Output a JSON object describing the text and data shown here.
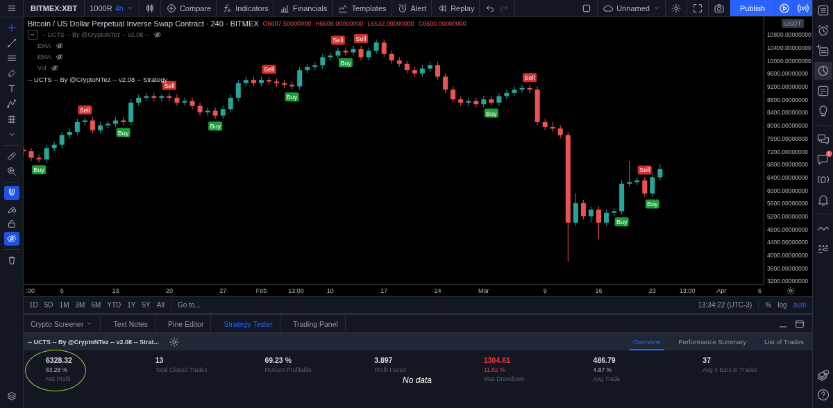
{
  "topbar": {
    "symbol": "BITMEX:XBT",
    "chart_style": "1000R",
    "interval": "4h",
    "buttons": [
      {
        "label": "Compare"
      },
      {
        "label": "Indicators"
      },
      {
        "label": "Financials"
      },
      {
        "label": "Templates"
      },
      {
        "label": "Alert"
      },
      {
        "label": "Replay"
      }
    ],
    "layout_name": "Unnamed",
    "publish": "Publish"
  },
  "left_toolbar": [
    {
      "selected": true,
      "on": false
    },
    {
      "selected": false,
      "on": false
    },
    {
      "selected": false,
      "on": false
    },
    {
      "selected": false,
      "on": false
    },
    {
      "selected": false,
      "on": false
    },
    {
      "selected": false,
      "on": false
    },
    {
      "selected": false,
      "on": false
    },
    {
      "selected": false,
      "on": false
    },
    {
      "selected": false,
      "on": false
    },
    {
      "selected": false,
      "on": false
    },
    {
      "selected": false,
      "on": true
    },
    {
      "selected": false,
      "on": false
    },
    {
      "selected": false,
      "on": false
    },
    {
      "selected": false,
      "on": true
    },
    {
      "selected": false,
      "on": false
    }
  ],
  "right_sidebar": [
    {
      "selected": false
    },
    {
      "selected": false
    },
    {
      "selected": false
    },
    {
      "selected": true
    },
    {
      "selected": false
    },
    {
      "selected": false
    },
    {
      "selected": false
    },
    {
      "selected": false,
      "badge": "1"
    },
    {
      "selected": false
    },
    {
      "selected": false
    },
    {
      "selected": false
    },
    {
      "selected": false
    },
    {
      "selected": false
    },
    {
      "selected": false
    }
  ],
  "chart": {
    "title": "Bitcoin / US Dollar Perpetual Inverse Swap Contract · 240 · BITMEX",
    "ohlc": [
      "O6607.50000000",
      "H6608.00000000",
      "L6532.00000000",
      "C6600.00000000"
    ],
    "indicators": [
      {
        "name": "-- UCTS -- By @CryptoNTez -- v2.08 --",
        "kind": "group"
      },
      {
        "name": "EMA",
        "kind": "study"
      },
      {
        "name": "EMA",
        "kind": "study"
      },
      {
        "name": "Vol",
        "kind": "study"
      },
      {
        "name": "-- UCTS -- By @CryptoNTez -- v2.08 -- Strategy",
        "kind": "strategy"
      }
    ],
    "currency": "USDT",
    "chart_data": {
      "type": "candlestick",
      "xlim": [
        "--01-01T00:00",
        "--04-06T12:00"
      ],
      "ylim": [
        3093,
        11350
      ],
      "xticks": [
        {
          "value": "--01-01T21:00",
          "label": ":00"
        },
        {
          "value": "--01-06",
          "label": "6"
        },
        {
          "value": "--01-13",
          "label": "13"
        },
        {
          "value": "--01-20",
          "label": "20"
        },
        {
          "value": "--01-27",
          "label": "27"
        },
        {
          "value": "--02-01",
          "label": "Feb"
        },
        {
          "value": "--02-05T13:00",
          "label": "13:00"
        },
        {
          "value": "--02-10",
          "label": "10"
        },
        {
          "value": "--02-17",
          "label": "17"
        },
        {
          "value": "--02-24",
          "label": "24"
        },
        {
          "value": "--03-01",
          "label": "Mar"
        },
        {
          "value": "--03-09",
          "label": "9"
        },
        {
          "value": "--03-16",
          "label": "16"
        },
        {
          "value": "--03-23",
          "label": "23"
        },
        {
          "value": "--03-27T13:00",
          "label": "13:00"
        },
        {
          "value": "--04-01",
          "label": "Apr"
        },
        {
          "value": "--04-06",
          "label": "6"
        }
      ],
      "yticks": [
        {
          "value": 3200,
          "label": "3200.00000000"
        },
        {
          "value": 3600,
          "label": "3600.00000000"
        },
        {
          "value": 4000,
          "label": "4000.00000000"
        },
        {
          "value": 4400,
          "label": "4400.00000000"
        },
        {
          "value": 4800,
          "label": "4800.00000000"
        },
        {
          "value": 5200,
          "label": "5200.00000000"
        },
        {
          "value": 5600,
          "label": "5600.00000000"
        },
        {
          "value": 6000,
          "label": "6000.00000000"
        },
        {
          "value": 6400,
          "label": "6400.00000000"
        },
        {
          "value": 6800,
          "label": "6800.00000000"
        },
        {
          "value": 7200,
          "label": "7200.00000000"
        },
        {
          "value": 7600,
          "label": "7600.00000000"
        },
        {
          "value": 8000,
          "label": "8000.00000000"
        },
        {
          "value": 8400,
          "label": "8400.00000000"
        },
        {
          "value": 8800,
          "label": "8800.00000000"
        },
        {
          "value": 9200,
          "label": "9200.00000000"
        },
        {
          "value": 9600,
          "label": "9600.00000000"
        },
        {
          "value": 10000,
          "label": "10000.00000000"
        },
        {
          "value": 10400,
          "label": "10400.00000000"
        },
        {
          "value": 10800,
          "label": "10800.00000000"
        }
      ],
      "x": [
        "--01-01",
        "--01-02",
        "--01-03",
        "--01-04",
        "--01-05",
        "--01-06",
        "--01-07",
        "--01-08",
        "--01-09",
        "--01-10",
        "--01-11",
        "--01-12",
        "--01-13",
        "--01-14",
        "--01-15",
        "--01-16",
        "--01-17",
        "--01-18",
        "--01-19",
        "--01-20",
        "--01-21",
        "--01-22",
        "--01-23",
        "--01-24",
        "--01-25",
        "--01-26",
        "--01-27",
        "--01-28",
        "--01-29",
        "--01-30",
        "--01-31",
        "--02-01",
        "--02-02",
        "--02-03",
        "--02-04",
        "--02-05",
        "--02-06",
        "--02-07",
        "--02-08",
        "--02-09",
        "--02-10",
        "--02-11",
        "--02-12",
        "--02-13",
        "--02-14",
        "--02-15",
        "--02-16",
        "--02-17",
        "--02-18",
        "--02-19",
        "--02-20",
        "--02-21",
        "--02-22",
        "--02-23",
        "--02-24",
        "--02-25",
        "--02-26",
        "--02-27",
        "--02-28",
        "--02-29",
        "--03-01",
        "--03-02",
        "--03-03",
        "--03-04",
        "--03-05",
        "--03-06",
        "--03-07",
        "--03-08",
        "--03-09",
        "--03-10",
        "--03-11",
        "--03-12",
        "--03-13",
        "--03-14",
        "--03-15",
        "--03-16",
        "--03-17",
        "--03-18",
        "--03-19",
        "--03-20",
        "--03-21",
        "--03-22",
        "--03-23",
        "--03-24"
      ],
      "ohlc": [
        [
          7250,
          7350,
          7100,
          7200
        ],
        [
          7200,
          7300,
          6900,
          7000
        ],
        [
          7000,
          7100,
          6850,
          6950
        ],
        [
          6950,
          7400,
          6850,
          7300
        ],
        [
          7300,
          7500,
          7200,
          7400
        ],
        [
          7400,
          7800,
          7300,
          7700
        ],
        [
          7700,
          7900,
          7600,
          7800
        ],
        [
          7800,
          8200,
          7700,
          8100
        ],
        [
          8100,
          8250,
          8000,
          8150
        ],
        [
          8150,
          8250,
          7750,
          7850
        ],
        [
          7850,
          8100,
          7750,
          8000
        ],
        [
          8000,
          8150,
          7900,
          8050
        ],
        [
          8050,
          8250,
          7950,
          8150
        ],
        [
          8150,
          8250,
          8000,
          8100
        ],
        [
          8100,
          8800,
          8000,
          8700
        ],
        [
          8700,
          8950,
          8600,
          8850
        ],
        [
          8850,
          9000,
          8750,
          8900
        ],
        [
          8900,
          9000,
          8750,
          8850
        ],
        [
          8850,
          8950,
          8750,
          8900
        ],
        [
          8900,
          9000,
          8750,
          8850
        ],
        [
          8850,
          8950,
          8600,
          8700
        ],
        [
          8700,
          8850,
          8600,
          8750
        ],
        [
          8750,
          8850,
          8500,
          8600
        ],
        [
          8600,
          8700,
          8300,
          8400
        ],
        [
          8400,
          8550,
          8300,
          8450
        ],
        [
          8450,
          8550,
          8200,
          8300
        ],
        [
          8300,
          8600,
          8200,
          8500
        ],
        [
          8500,
          8950,
          8400,
          8850
        ],
        [
          8850,
          9400,
          8750,
          9300
        ],
        [
          9300,
          9500,
          9200,
          9400
        ],
        [
          9400,
          9500,
          9200,
          9300
        ],
        [
          9300,
          9500,
          9200,
          9400
        ],
        [
          9400,
          9500,
          9250,
          9350
        ],
        [
          9350,
          9450,
          9200,
          9300
        ],
        [
          9300,
          9400,
          9150,
          9250
        ],
        [
          9250,
          9350,
          9100,
          9200
        ],
        [
          9200,
          9800,
          9100,
          9700
        ],
        [
          9700,
          9900,
          9600,
          9800
        ],
        [
          9800,
          9950,
          9700,
          9850
        ],
        [
          9850,
          10200,
          9750,
          10100
        ],
        [
          10100,
          10250,
          10000,
          10150
        ],
        [
          10150,
          10400,
          10050,
          10300
        ],
        [
          10300,
          10400,
          10150,
          10250
        ],
        [
          10250,
          10450,
          10150,
          10350
        ],
        [
          10350,
          10450,
          10000,
          10100
        ],
        [
          10100,
          10400,
          10000,
          10300
        ],
        [
          10300,
          10650,
          10200,
          10550
        ],
        [
          10550,
          10650,
          10100,
          10200
        ],
        [
          10200,
          10300,
          9900,
          10000
        ],
        [
          10000,
          10100,
          9800,
          9900
        ],
        [
          9900,
          10000,
          9600,
          9700
        ],
        [
          9700,
          9800,
          9500,
          9600
        ],
        [
          9600,
          9850,
          9500,
          9750
        ],
        [
          9750,
          9950,
          9650,
          9850
        ],
        [
          9850,
          9950,
          9400,
          9500
        ],
        [
          9500,
          9600,
          9000,
          9100
        ],
        [
          9100,
          9200,
          8700,
          8800
        ],
        [
          8800,
          8900,
          8600,
          8700
        ],
        [
          8700,
          8850,
          8600,
          8750
        ],
        [
          8750,
          8850,
          8550,
          8650
        ],
        [
          8650,
          8900,
          8550,
          8800
        ],
        [
          8800,
          8900,
          8600,
          8700
        ],
        [
          8700,
          9000,
          8600,
          8900
        ],
        [
          8900,
          9100,
          8800,
          9000
        ],
        [
          9000,
          9200,
          8900,
          9100
        ],
        [
          9100,
          9250,
          9000,
          9150
        ],
        [
          9150,
          9250,
          9000,
          9100
        ],
        [
          9100,
          9200,
          8000,
          8100
        ],
        [
          8100,
          8200,
          7850,
          7950
        ],
        [
          7950,
          8100,
          7800,
          7900
        ],
        [
          7900,
          8000,
          7600,
          7700
        ],
        [
          7700,
          7800,
          3800,
          5000
        ],
        [
          5000,
          5900,
          4900,
          5600
        ],
        [
          5600,
          5700,
          5100,
          5200
        ],
        [
          5200,
          5500,
          5000,
          5400
        ],
        [
          5400,
          5500,
          4500,
          5000
        ],
        [
          5000,
          5400,
          4900,
          5300
        ],
        [
          5300,
          5450,
          5200,
          5350
        ],
        [
          5350,
          6300,
          5250,
          6200
        ],
        [
          6200,
          6900,
          6100,
          6250
        ],
        [
          6250,
          6400,
          6150,
          6300
        ],
        [
          6300,
          6400,
          5800,
          5900
        ],
        [
          5900,
          6500,
          5800,
          6400
        ],
        [
          6400,
          6800,
          6300,
          6650
        ]
      ],
      "annotations": [
        {
          "x": "--01-03",
          "y": 6850,
          "text": "Buy"
        },
        {
          "x": "--01-09",
          "y": 8250,
          "text": "Sell"
        },
        {
          "x": "--01-14",
          "y": 8000,
          "text": "Buy"
        },
        {
          "x": "--01-20",
          "y": 9000,
          "text": "Sell"
        },
        {
          "x": "--01-26",
          "y": 8200,
          "text": "Buy"
        },
        {
          "x": "--02-02",
          "y": 9500,
          "text": "Sell"
        },
        {
          "x": "--02-05",
          "y": 9100,
          "text": "Buy"
        },
        {
          "x": "--02-11",
          "y": 10400,
          "text": "Sell"
        },
        {
          "x": "--02-12",
          "y": 10150,
          "text": "Buy"
        },
        {
          "x": "--02-14",
          "y": 10450,
          "text": "Sell"
        },
        {
          "x": "--03-02",
          "y": 8600,
          "text": "Buy"
        },
        {
          "x": "--03-07",
          "y": 9250,
          "text": "Sell"
        },
        {
          "x": "--03-19",
          "y": 5250,
          "text": "Buy"
        },
        {
          "x": "--03-22",
          "y": 6400,
          "text": "Sell"
        },
        {
          "x": "--03-23",
          "y": 5800,
          "text": "Buy"
        }
      ]
    }
  },
  "range_bar": {
    "ranges": [
      "1D",
      "5D",
      "1M",
      "3M",
      "6M",
      "YTD",
      "1Y",
      "5Y",
      "All"
    ],
    "goto": "Go to...",
    "clock": "13:34:22 (UTC-3)",
    "scale_options": [
      {
        "label": "%",
        "selected": false
      },
      {
        "label": "log",
        "selected": false
      },
      {
        "label": "auto",
        "selected": true
      }
    ]
  },
  "panel_tabs": [
    {
      "label": "Crypto Screener",
      "selected": false,
      "dropdown": true
    },
    {
      "label": "Text Notes",
      "selected": false,
      "dropdown": false
    },
    {
      "label": "Pine Editor",
      "selected": false,
      "dropdown": false
    },
    {
      "label": "Strategy Tester",
      "selected": true,
      "dropdown": false
    },
    {
      "label": "Trading Panel",
      "selected": false,
      "dropdown": false
    }
  ],
  "strategy": {
    "name": "-- UCTS -- By @CryptoNTez -- v2.08 -- Strat...",
    "tabs": [
      {
        "label": "Overview",
        "selected": true
      },
      {
        "label": "Performance Summary",
        "selected": false
      },
      {
        "label": "List of Trades",
        "selected": false
      }
    ],
    "stats": [
      {
        "value": "6328.32",
        "percent": "63.28 %",
        "label": "Net Profit",
        "negative": false,
        "circled": true
      },
      {
        "value": "13",
        "label": "Total Closed Trades",
        "negative": false,
        "circled": false
      },
      {
        "value": "69.23 %",
        "label": "Percent Profitable",
        "negative": false,
        "circled": false
      },
      {
        "value": "3.897",
        "label": "Profit Factor",
        "negative": false,
        "circled": false
      },
      {
        "value": "1304.61",
        "percent": "11.82 %",
        "label": "Max Drawdown",
        "negative": true,
        "circled": false
      },
      {
        "value": "486.79",
        "percent": "4.87 %",
        "label": "Avg Trade",
        "negative": false,
        "circled": false
      },
      {
        "value": "37",
        "label": "Avg # Bars in Trades",
        "negative": false,
        "circled": false
      }
    ],
    "overlay_text": "No data"
  }
}
